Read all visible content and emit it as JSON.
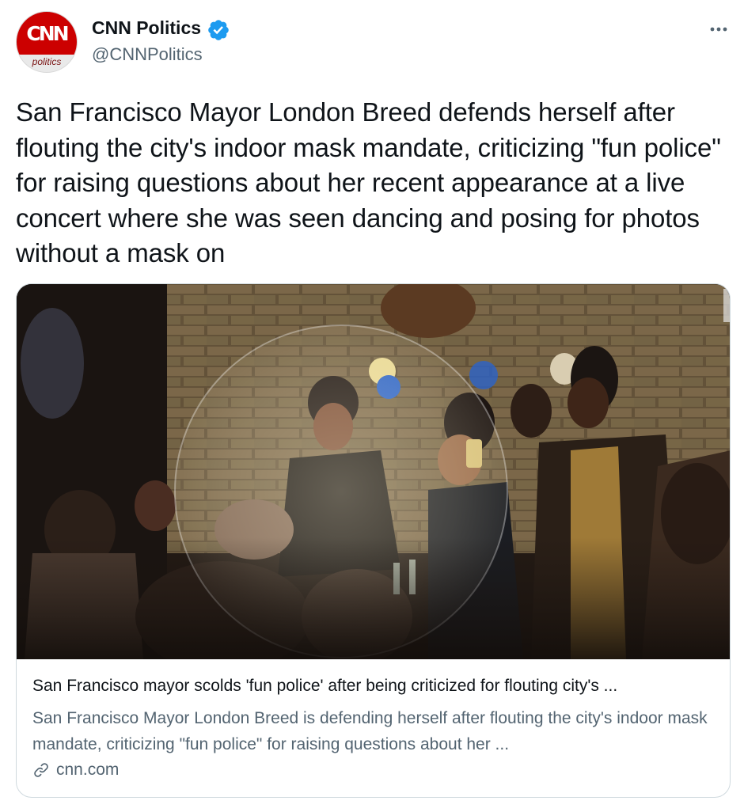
{
  "author": {
    "avatar_logo": "CNN",
    "avatar_sub": "politics",
    "display_name": "CNN Politics",
    "handle": "@CNNPolitics",
    "verified": true
  },
  "tweet": {
    "text": "San Francisco Mayor London Breed defends herself after flouting the city's indoor mask mandate, criticizing \"fun police\" for raising questions about her recent appearance at a live concert where she was seen dancing and posing for photos without a mask on"
  },
  "card": {
    "title": "San Francisco mayor scolds 'fun police' after being criticized for flouting city's ...",
    "description": "San Francisco Mayor London Breed is defending herself after flouting the city's indoor mask mandate, criticizing \"fun police\" for raising questions about her ...",
    "domain": "cnn.com"
  },
  "icons": {
    "verified": "verified-badge-icon",
    "more": "more-options-icon",
    "link": "link-icon"
  },
  "colors": {
    "brand_red": "#cc0000",
    "verified_blue": "#1d9bf0",
    "secondary_text": "#536471",
    "border": "#cfd9de"
  }
}
